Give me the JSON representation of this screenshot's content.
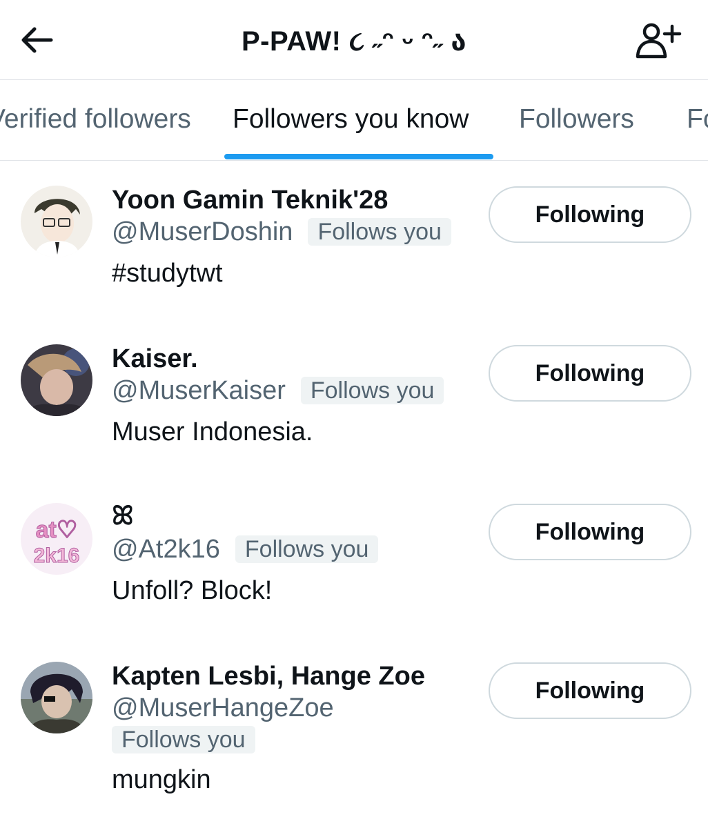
{
  "header": {
    "title": "P-PAW! ૮ ˶ᵔ ᵕ ᵔ˶ ა",
    "back_icon": "arrow-left-icon",
    "add_icon": "add-user-icon"
  },
  "tabs": [
    {
      "label": "Verified followers"
    },
    {
      "label": "Followers you know"
    },
    {
      "label": "Followers"
    },
    {
      "label": "Following"
    }
  ],
  "accent_color": "#1d9bf0",
  "users": [
    {
      "name": "Yoon Gamin Teknik'28",
      "handle": "@MuserDoshin",
      "badge": "Follows you",
      "bio": "#studytwt",
      "button": "Following"
    },
    {
      "name": "Kaiser.",
      "handle": "@MuserKaiser",
      "badge": "Follows you",
      "bio": "Muser Indonesia.",
      "button": "Following"
    },
    {
      "name": "ꕤ",
      "handle": "@At2k16",
      "badge": "Follows you",
      "bio": "Unfoll? Block!",
      "button": "Following",
      "avatar_text": "at♡ 2k16"
    },
    {
      "name": "Kapten Lesbi, Hange Zoe",
      "handle": "@MuserHangeZoe",
      "badge": "Follows you",
      "bio": "mungkin",
      "button": "Following"
    }
  ]
}
